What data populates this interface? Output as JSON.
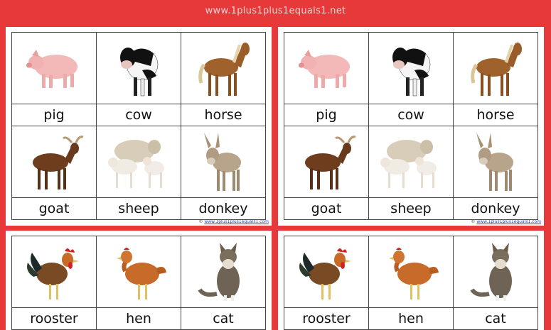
{
  "site_url": "www.1plus1plus1equals1.net",
  "credit": {
    "symbol": "©",
    "link": "www.1plus1plus1equals1.com"
  },
  "cards": [
    {
      "rows": [
        [
          {
            "label": "pig",
            "icon": "pig-photo"
          },
          {
            "label": "cow",
            "icon": "cow-photo"
          },
          {
            "label": "horse",
            "icon": "horse-photo"
          }
        ],
        [
          {
            "label": "goat",
            "icon": "goat-photo"
          },
          {
            "label": "sheep",
            "icon": "sheep-photo"
          },
          {
            "label": "donkey",
            "icon": "donkey-photo"
          }
        ]
      ]
    },
    {
      "rows": [
        [
          {
            "label": "pig",
            "icon": "pig-photo"
          },
          {
            "label": "cow",
            "icon": "cow-photo"
          },
          {
            "label": "horse",
            "icon": "horse-photo"
          }
        ],
        [
          {
            "label": "goat",
            "icon": "goat-photo"
          },
          {
            "label": "sheep",
            "icon": "sheep-photo"
          },
          {
            "label": "donkey",
            "icon": "donkey-photo"
          }
        ]
      ]
    },
    {
      "rows": [
        [
          {
            "label": "rooster",
            "icon": "rooster-photo"
          },
          {
            "label": "hen",
            "icon": "hen-photo"
          },
          {
            "label": "cat",
            "icon": "cat-photo"
          }
        ]
      ]
    },
    {
      "rows": [
        [
          {
            "label": "rooster",
            "icon": "rooster-photo"
          },
          {
            "label": "hen",
            "icon": "hen-photo"
          },
          {
            "label": "cat",
            "icon": "cat-photo"
          }
        ]
      ]
    }
  ]
}
